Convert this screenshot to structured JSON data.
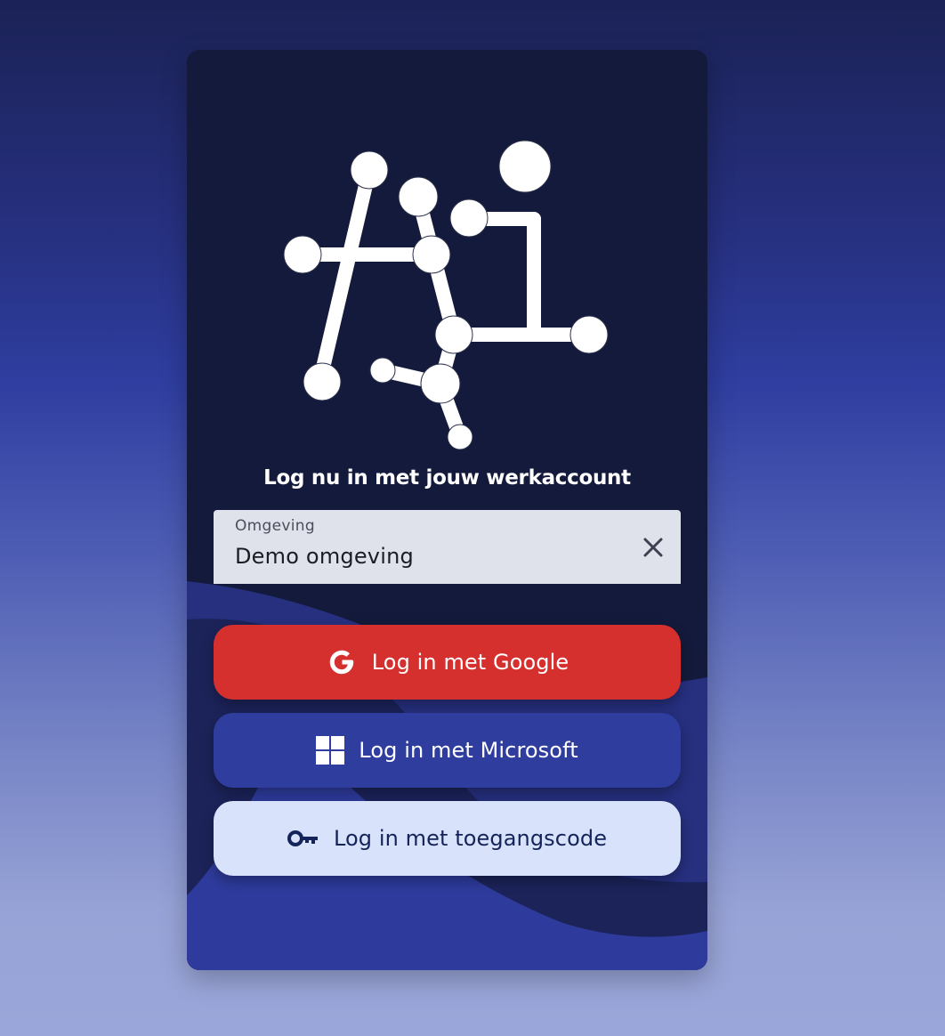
{
  "login": {
    "headline": "Log nu in met jouw werkaccount",
    "environment_field": {
      "label": "Omgeving",
      "value": "Demo omgeving",
      "clear_icon": "close-icon"
    },
    "buttons": {
      "google": {
        "label": "Log in met Google",
        "icon": "google-icon",
        "color": "#d52f2e"
      },
      "microsoft": {
        "label": "Log in met Microsoft",
        "icon": "windows-icon",
        "color": "#2f3d9f"
      },
      "access_code": {
        "label": "Log in met toegangscode",
        "icon": "key-icon",
        "color": "#d8e3fb"
      }
    }
  },
  "colors": {
    "card_background": "#141a3b",
    "wave": "#2e3b9c",
    "field_background": "#dfe2ea"
  },
  "logo": {
    "icon": "ai-molecule-logo"
  }
}
